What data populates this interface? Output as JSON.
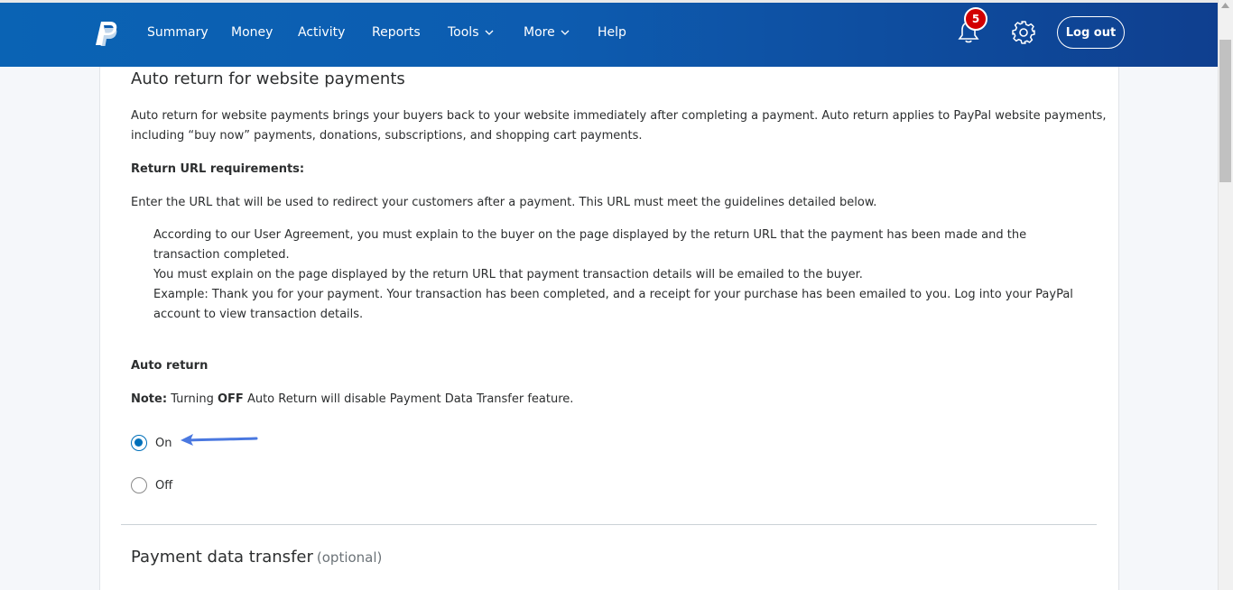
{
  "nav": {
    "items": [
      {
        "label": "Summary"
      },
      {
        "label": "Money"
      },
      {
        "label": "Activity"
      },
      {
        "label": "Reports"
      },
      {
        "label": "Tools"
      },
      {
        "label": "More"
      },
      {
        "label": "Help"
      }
    ],
    "notification_count": "5",
    "logout_label": "Log out",
    "icons": [
      "paypal-logo",
      "bell-icon",
      "gear-icon",
      "chevron-down-icon"
    ],
    "colors": {
      "bar_start": "#0a63b4",
      "bar_end": "#0f3f8f",
      "badge": "#d20000"
    }
  },
  "section": {
    "title": "Auto return for website payments",
    "description_line1": "Auto return for website payments brings your buyers back to your website immediately after completing a payment. Auto return applies to PayPal website payments,",
    "description_line2": "including “buy now” payments, donations, subscriptions, and shopping cart payments.",
    "requirements_heading": "Return URL requirements:",
    "requirements_intro": "Enter the URL that will be used to redirect your customers after a payment. This URL must meet the guidelines detailed below.",
    "guidelines": [
      "According to our User Agreement, you must explain to the buyer on the page displayed by the return URL that the payment has been made and the transaction completed.",
      "You must explain on the page displayed by the return URL that payment transaction details will be emailed to the buyer.",
      "Example: Thank you for your payment. Your transaction has been completed, and a receipt for your purchase has been emailed to you. Log into your PayPal account to view transaction details."
    ],
    "auto_return_heading": "Auto return",
    "note_label": "Note:",
    "note_text_1": "Turning",
    "note_off": "OFF",
    "note_text_2": "Auto Return will disable Payment Data Transfer feature.",
    "options": [
      {
        "label": "On",
        "selected": true
      },
      {
        "label": "Off",
        "selected": false
      }
    ],
    "accent_color": "#0070ba",
    "annotation_arrow_color": "#4a78e0"
  },
  "next_section": {
    "title": "Payment data transfer",
    "optional": "(optional)"
  }
}
